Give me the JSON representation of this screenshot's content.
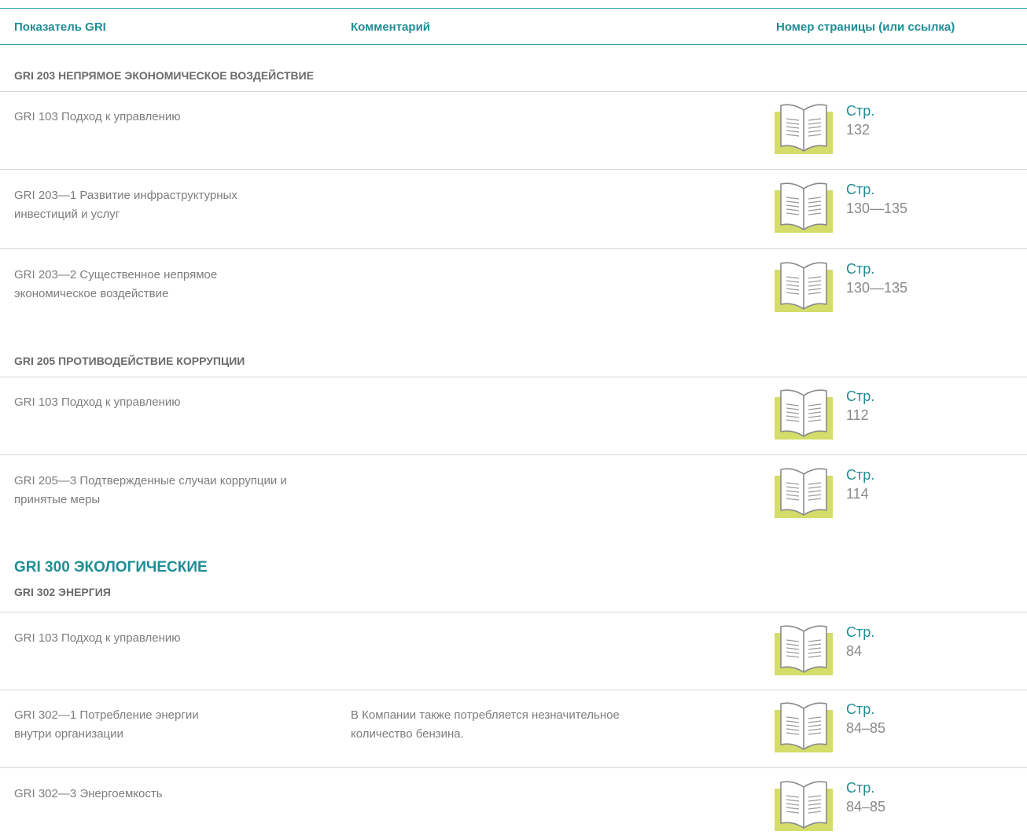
{
  "header": {
    "col1": "Показатель GRI",
    "col2": "Комментарий",
    "col3": "Номер страницы (или ссылка)"
  },
  "sections": {
    "s203": "GRI 203 НЕПРЯМОЕ ЭКОНОМИЧЕСКОЕ ВОЗДЕЙСТВИЕ",
    "s205": "GRI 205 ПРОТИВОДЕЙСТВИЕ КОРРУПЦИИ",
    "major300": "GRI 300 ЭКОЛОГИЧЕСКИЕ",
    "s302": "GRI 302 ЭНЕРГИЯ"
  },
  "page_label": "Стр.",
  "icon": "open-book-icon",
  "colors": {
    "accent": "#1f8d96",
    "book_yellow": "#d4dc6a",
    "divider": "#d6d6d6"
  },
  "rows": [
    {
      "indicator": "GRI 103 Подход к управлению",
      "comment": "",
      "pages": "132"
    },
    {
      "indicator": "GRI 203—1 Развитие инфраструктурных инвестиций и услуг",
      "comment": "",
      "pages": "130—135"
    },
    {
      "indicator": "GRI 203—2 Существенное непрямое экономическое воздействие",
      "comment": "",
      "pages": "130—135"
    },
    {
      "indicator": "GRI 103 Подход к управлению",
      "comment": "",
      "pages": "112"
    },
    {
      "indicator": "GRI 205—3 Подтвержденные случаи коррупции и принятые меры",
      "comment": "",
      "pages": "114"
    },
    {
      "indicator": "GRI 103 Подход к управлению",
      "comment": "",
      "pages": "84"
    },
    {
      "indicator": "GRI 302—1 Потребление энергии внутри организации",
      "comment": "В Компании также потребляется незначительное количество бензина.",
      "pages": "84–85"
    },
    {
      "indicator": "GRI 302—3 Энергоемкость",
      "comment": "",
      "pages": "84–85"
    }
  ]
}
